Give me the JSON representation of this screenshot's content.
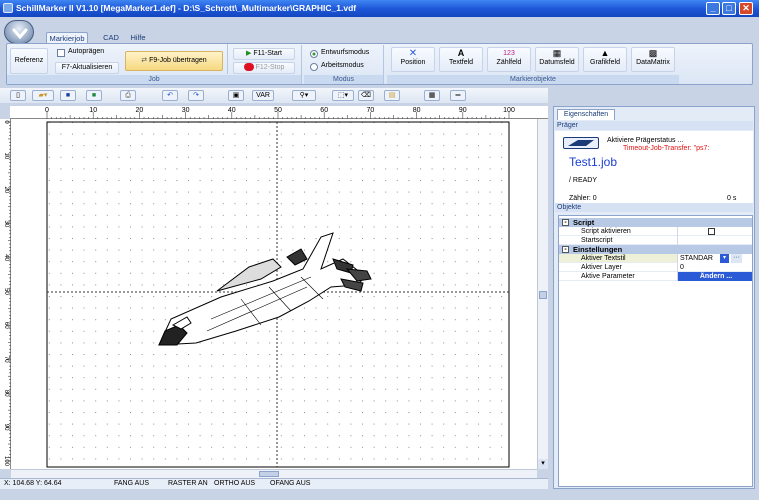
{
  "window": {
    "title": "SchillMarker II V1.10 [MegaMarker1.def] - D:\\S_Schrott\\_Multimarker\\GRAPHIC_1.vdf",
    "btn_min": "_",
    "btn_max": "□",
    "btn_close": "✕"
  },
  "ribbon": {
    "tabs": [
      "Markierjob",
      "CAD",
      "Hilfe"
    ],
    "job": {
      "referenz": "Referenz",
      "autopraegen": "Autoprägen",
      "f7": "F7-Aktualisieren",
      "f9": "F9-Job übertragen",
      "group": "Job"
    },
    "run": {
      "f11": "F11-Start",
      "f12": "F12-Stop"
    },
    "modus": {
      "entwurf": "Entwurfsmodus",
      "arbeit": "Arbeitsmodus",
      "group": "Modus"
    },
    "objekte": {
      "items": [
        "Position",
        "Textfeld",
        "Zählfeld",
        "Datumsfeld",
        "Grafikfeld",
        "DataMatrix"
      ],
      "group": "Markierobjekte"
    }
  },
  "toolbar": {
    "var": "VAR"
  },
  "ruler": {
    "h": [
      "0",
      "10",
      "20",
      "30",
      "40",
      "50",
      "60",
      "70",
      "80",
      "90",
      "100"
    ],
    "v": [
      "0",
      "10",
      "20",
      "30",
      "40",
      "50",
      "60",
      "70",
      "80",
      "90",
      "100"
    ]
  },
  "status": {
    "coords": "X: 104.68  Y: 64.64",
    "fang": "FANG AUS",
    "raster": "RASTER AN",
    "ortho": "ORTHO AUS",
    "ofang": "OFANG AUS"
  },
  "panel": {
    "tab": "Eigenschaften",
    "praeger_header": "Präger",
    "status_title": "Aktiviere Prägerstatus ...",
    "status_error": "Timeout-Job-Transfer: \"ps7:",
    "job_name": "Test1.job",
    "ready": "/  READY",
    "zaehler": "Zähler: 0",
    "zeit": "0 s",
    "objekte_header": "Objekte",
    "cat_script": "Script",
    "script_aktivieren": "Script aktivieren",
    "startscript": "Startscript",
    "cat_einstellungen": "Einstellungen",
    "textstil": "Aktiver Textstil",
    "textstil_val": "STANDAR",
    "layer": "Aktiver Layer",
    "layer_val": "0",
    "parameter": "Aktive Parameter",
    "parameter_val": "Ändern ..."
  }
}
